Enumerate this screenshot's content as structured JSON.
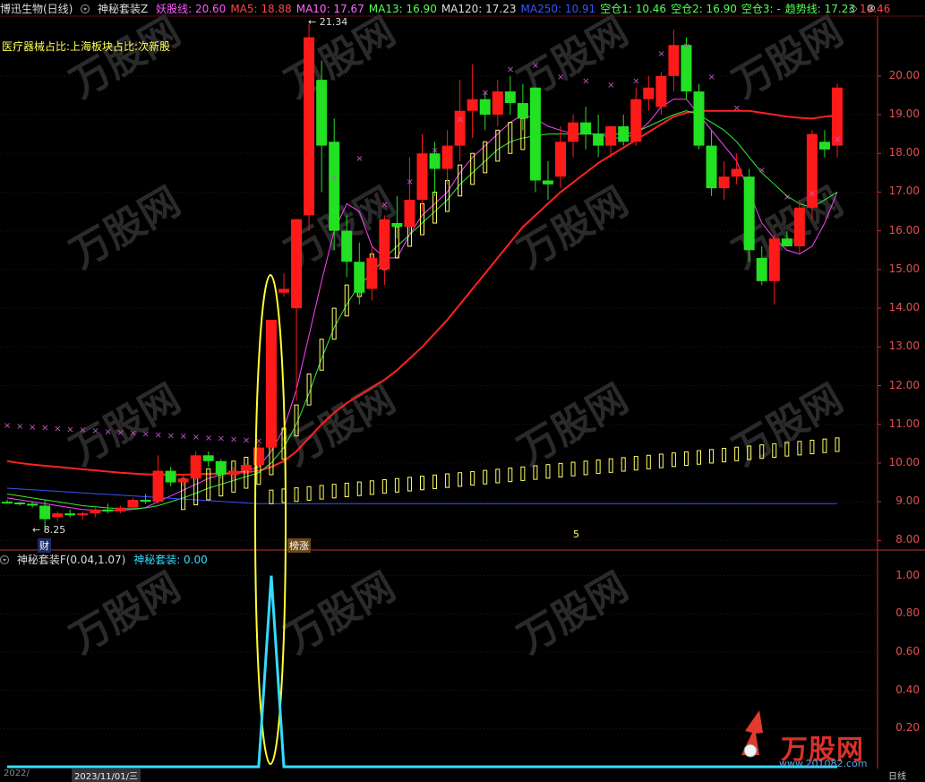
{
  "header": {
    "stock_name": "博迅生物(日线)",
    "indicator_name": "神秘套装Z",
    "values": [
      {
        "label": "妖股线: 20.60",
        "color": "#ff55ff"
      },
      {
        "label": "MA5: 18.88",
        "color": "#ff4444"
      },
      {
        "label": "MA10: 17.67",
        "color": "#ff66ff"
      },
      {
        "label": "MA13: 16.90",
        "color": "#55ff55"
      },
      {
        "label": "MA120: 17.23",
        "color": "#dddddd"
      },
      {
        "label": "MA250: 10.91",
        "color": "#3355ff"
      },
      {
        "label": "空仓1: 10.46",
        "color": "#55ff55"
      },
      {
        "label": "空仓2: 16.90",
        "color": "#55ff55"
      },
      {
        "label": "空仓3: -",
        "color": "#55ff55"
      },
      {
        "label": "趋势线: 17.23",
        "color": "#55ff55"
      },
      {
        "label": "10.46",
        "color": "#ff4444"
      }
    ]
  },
  "sector_line": "医疗器械占比:上海板块占比:次新股",
  "window_buttons": {
    "diamond": "◇",
    "close": "⊗"
  },
  "price_axis": [
    "20.00",
    "19.00",
    "18.00",
    "17.00",
    "16.00",
    "15.00",
    "14.00",
    "13.00",
    "12.00",
    "11.00",
    "10.00",
    "9.00",
    "8.00"
  ],
  "annotations": {
    "high": "21.34",
    "low": "8.25",
    "cai": "财",
    "bang": "榜涨",
    "five": "5"
  },
  "sub_header": {
    "indicator": "神秘套装F(0.04,1.07)",
    "value_label": "神秘套装: 0.00",
    "value_color": "#33ddff"
  },
  "sub_axis": [
    "1.00",
    "0.80",
    "0.60",
    "0.40",
    "0.20"
  ],
  "footer": {
    "left": "2022/",
    "date": "2023/11/01/三",
    "right": "日线"
  },
  "watermark": {
    "brand": "万股网",
    "url": "www.201082.com"
  },
  "colors": {
    "up": "#ff1a1a",
    "down": "#22e022",
    "ellipse": "#ffff33",
    "spike": "#33ddff"
  },
  "chart_data": [
    {
      "type": "candlestick",
      "title": "博迅生物(日线)",
      "ylim": [
        7.8,
        21.5
      ],
      "candles": [
        {
          "o": 9.0,
          "h": 9.05,
          "l": 8.95,
          "c": 8.98
        },
        {
          "o": 8.98,
          "h": 9.0,
          "l": 8.9,
          "c": 8.95
        },
        {
          "o": 8.95,
          "h": 9.0,
          "l": 8.85,
          "c": 8.9
        },
        {
          "o": 8.9,
          "h": 9.05,
          "l": 8.25,
          "c": 8.55
        },
        {
          "o": 8.6,
          "h": 8.75,
          "l": 8.5,
          "c": 8.7
        },
        {
          "o": 8.7,
          "h": 8.8,
          "l": 8.6,
          "c": 8.65
        },
        {
          "o": 8.65,
          "h": 8.75,
          "l": 8.55,
          "c": 8.7
        },
        {
          "o": 8.7,
          "h": 8.85,
          "l": 8.6,
          "c": 8.8
        },
        {
          "o": 8.8,
          "h": 8.95,
          "l": 8.7,
          "c": 8.75
        },
        {
          "o": 8.75,
          "h": 8.9,
          "l": 8.7,
          "c": 8.85
        },
        {
          "o": 8.85,
          "h": 9.1,
          "l": 8.8,
          "c": 9.05
        },
        {
          "o": 9.05,
          "h": 9.2,
          "l": 8.95,
          "c": 9.0
        },
        {
          "o": 9.0,
          "h": 10.2,
          "l": 8.95,
          "c": 9.8
        },
        {
          "o": 9.8,
          "h": 9.9,
          "l": 9.4,
          "c": 9.5
        },
        {
          "o": 9.5,
          "h": 9.7,
          "l": 9.4,
          "c": 9.6
        },
        {
          "o": 9.6,
          "h": 10.3,
          "l": 9.55,
          "c": 10.2
        },
        {
          "o": 10.2,
          "h": 10.3,
          "l": 9.9,
          "c": 10.05
        },
        {
          "o": 10.05,
          "h": 10.1,
          "l": 9.6,
          "c": 9.7
        },
        {
          "o": 9.7,
          "h": 9.9,
          "l": 9.55,
          "c": 9.8
        },
        {
          "o": 9.8,
          "h": 10.0,
          "l": 9.7,
          "c": 9.95
        },
        {
          "o": 9.95,
          "h": 10.5,
          "l": 9.9,
          "c": 10.4
        },
        {
          "o": 10.4,
          "h": 13.6,
          "l": 10.3,
          "c": 13.7
        },
        {
          "o": 14.4,
          "h": 14.9,
          "l": 14.3,
          "c": 14.5
        },
        {
          "o": 14.0,
          "h": 16.3,
          "l": 11.6,
          "c": 16.3
        },
        {
          "o": 16.4,
          "h": 21.34,
          "l": 16.0,
          "c": 21.0
        },
        {
          "o": 19.9,
          "h": 20.4,
          "l": 17.0,
          "c": 18.2
        },
        {
          "o": 18.3,
          "h": 18.9,
          "l": 15.5,
          "c": 16.0
        },
        {
          "o": 16.0,
          "h": 16.4,
          "l": 14.8,
          "c": 15.2
        },
        {
          "o": 15.2,
          "h": 15.7,
          "l": 14.1,
          "c": 14.4
        },
        {
          "o": 14.5,
          "h": 15.6,
          "l": 14.2,
          "c": 15.3
        },
        {
          "o": 15.0,
          "h": 16.4,
          "l": 14.6,
          "c": 16.3
        },
        {
          "o": 16.2,
          "h": 16.9,
          "l": 15.8,
          "c": 16.1
        },
        {
          "o": 16.1,
          "h": 17.9,
          "l": 15.9,
          "c": 16.8
        },
        {
          "o": 16.8,
          "h": 18.5,
          "l": 16.5,
          "c": 18.0
        },
        {
          "o": 18.0,
          "h": 18.3,
          "l": 16.9,
          "c": 17.6
        },
        {
          "o": 17.6,
          "h": 18.6,
          "l": 17.2,
          "c": 18.2
        },
        {
          "o": 18.2,
          "h": 19.9,
          "l": 17.8,
          "c": 19.1
        },
        {
          "o": 19.1,
          "h": 20.3,
          "l": 18.4,
          "c": 19.4
        },
        {
          "o": 19.4,
          "h": 19.6,
          "l": 18.6,
          "c": 19.0
        },
        {
          "o": 19.0,
          "h": 19.9,
          "l": 18.7,
          "c": 19.6
        },
        {
          "o": 19.6,
          "h": 20.0,
          "l": 19.0,
          "c": 19.3
        },
        {
          "o": 19.3,
          "h": 19.8,
          "l": 18.6,
          "c": 18.9
        },
        {
          "o": 19.7,
          "h": 19.7,
          "l": 17.0,
          "c": 17.3
        },
        {
          "o": 17.3,
          "h": 17.8,
          "l": 16.8,
          "c": 17.2
        },
        {
          "o": 17.4,
          "h": 18.7,
          "l": 17.1,
          "c": 18.3
        },
        {
          "o": 18.3,
          "h": 19.0,
          "l": 17.9,
          "c": 18.8
        },
        {
          "o": 18.8,
          "h": 19.2,
          "l": 18.1,
          "c": 18.5
        },
        {
          "o": 18.5,
          "h": 19.0,
          "l": 17.9,
          "c": 18.2
        },
        {
          "o": 18.2,
          "h": 18.7,
          "l": 17.9,
          "c": 18.7
        },
        {
          "o": 18.7,
          "h": 19.0,
          "l": 18.2,
          "c": 18.3
        },
        {
          "o": 18.3,
          "h": 19.7,
          "l": 18.2,
          "c": 19.4
        },
        {
          "o": 19.4,
          "h": 20.0,
          "l": 19.1,
          "c": 19.7
        },
        {
          "o": 19.2,
          "h": 20.1,
          "l": 19.0,
          "c": 20.0
        },
        {
          "o": 20.0,
          "h": 21.2,
          "l": 19.6,
          "c": 20.8
        },
        {
          "o": 20.8,
          "h": 21.0,
          "l": 19.4,
          "c": 19.6
        },
        {
          "o": 19.6,
          "h": 19.8,
          "l": 18.1,
          "c": 18.2
        },
        {
          "o": 18.2,
          "h": 18.6,
          "l": 16.9,
          "c": 17.1
        },
        {
          "o": 17.1,
          "h": 17.8,
          "l": 16.8,
          "c": 17.4
        },
        {
          "o": 17.4,
          "h": 18.0,
          "l": 17.2,
          "c": 17.6
        },
        {
          "o": 17.4,
          "h": 17.6,
          "l": 15.2,
          "c": 15.5
        },
        {
          "o": 15.3,
          "h": 15.6,
          "l": 14.6,
          "c": 14.7
        },
        {
          "o": 14.7,
          "h": 15.9,
          "l": 14.1,
          "c": 15.8
        },
        {
          "o": 15.8,
          "h": 16.0,
          "l": 15.6,
          "c": 15.6
        },
        {
          "o": 15.6,
          "h": 16.8,
          "l": 15.4,
          "c": 16.6
        },
        {
          "o": 16.6,
          "h": 18.6,
          "l": 16.3,
          "c": 18.5
        },
        {
          "o": 18.3,
          "h": 18.6,
          "l": 17.9,
          "c": 18.1
        },
        {
          "o": 18.2,
          "h": 19.8,
          "l": 17.9,
          "c": 19.7
        }
      ],
      "series": [
        {
          "color": "#ff2222",
          "values": [
            10.05,
            10.0,
            9.96,
            9.93,
            9.9,
            9.87,
            9.84,
            9.81,
            9.78,
            9.75,
            9.73,
            9.71,
            9.7,
            9.7,
            9.7,
            9.71,
            9.72,
            9.73,
            9.74,
            9.76,
            9.8,
            9.9,
            10.05,
            10.3,
            10.65,
            11.0,
            11.3,
            11.55,
            11.75,
            11.95,
            12.15,
            12.4,
            12.7,
            13.0,
            13.35,
            13.7,
            14.1,
            14.5,
            14.9,
            15.3,
            15.7,
            16.1,
            16.4,
            16.7,
            17.0,
            17.25,
            17.5,
            17.75,
            17.95,
            18.15,
            18.35,
            18.55,
            18.75,
            18.95,
            19.05,
            19.1,
            19.1,
            19.1,
            19.1,
            19.1,
            19.05,
            19.0,
            18.95,
            18.92,
            18.9,
            18.95,
            18.98
          ]
        },
        {
          "color": "#ff44ff",
          "values": [
            9.1,
            9.05,
            9.0,
            8.95,
            8.9,
            8.85,
            8.8,
            8.78,
            8.76,
            8.78,
            8.8,
            8.85,
            9.0,
            9.15,
            9.3,
            9.45,
            9.6,
            9.7,
            9.75,
            9.8,
            9.9,
            10.3,
            10.9,
            11.9,
            13.3,
            14.7,
            16.0,
            16.7,
            16.5,
            15.6,
            15.3,
            15.3,
            15.9,
            16.4,
            16.7,
            17.0,
            17.5,
            17.9,
            18.2,
            18.5,
            18.8,
            19.0,
            18.9,
            18.7,
            18.6,
            18.5,
            18.5,
            18.5,
            18.4,
            18.4,
            18.5,
            18.8,
            19.2,
            19.4,
            19.4,
            19.0,
            18.6,
            18.2,
            17.8,
            17.0,
            16.2,
            15.8,
            15.5,
            15.4,
            15.6,
            16.2,
            17.0
          ]
        },
        {
          "color": "#33ee33",
          "values": [
            9.2,
            9.15,
            9.1,
            9.05,
            9.0,
            8.95,
            8.9,
            8.87,
            8.84,
            8.82,
            8.82,
            8.84,
            8.9,
            9.0,
            9.1,
            9.22,
            9.35,
            9.45,
            9.55,
            9.65,
            9.75,
            10.0,
            10.4,
            11.0,
            11.8,
            12.7,
            13.5,
            14.1,
            14.6,
            14.9,
            15.3,
            15.6,
            15.9,
            16.2,
            16.5,
            16.8,
            17.2,
            17.5,
            17.8,
            18.1,
            18.3,
            18.4,
            18.45,
            18.5,
            18.5,
            18.5,
            18.5,
            18.5,
            18.5,
            18.5,
            18.55,
            18.7,
            18.85,
            19.0,
            19.1,
            19.0,
            18.8,
            18.6,
            18.3,
            17.9,
            17.5,
            17.2,
            16.9,
            16.7,
            16.6,
            16.8,
            17.0
          ]
        },
        {
          "color": "#3355ff",
          "values": [
            9.35,
            9.33,
            9.31,
            9.29,
            9.27,
            9.25,
            9.23,
            9.21,
            9.19,
            9.17,
            9.15,
            9.13,
            9.11,
            9.09,
            9.07,
            9.05,
            9.03,
            9.01,
            8.99,
            8.97,
            8.95,
            8.95,
            8.95,
            8.95,
            8.95,
            8.95,
            8.95,
            8.95,
            8.95,
            8.95,
            8.95,
            8.95,
            8.95,
            8.95,
            8.95,
            8.95,
            8.95,
            8.95,
            8.95,
            8.95,
            8.95,
            8.95,
            8.95,
            8.95,
            8.95,
            8.95,
            8.95,
            8.95,
            8.95,
            8.95,
            8.95,
            8.95,
            8.95,
            8.95,
            8.95,
            8.95,
            8.95,
            8.95,
            8.95,
            8.95,
            8.95,
            8.95,
            8.95,
            8.95,
            8.95,
            8.95,
            8.95
          ]
        }
      ]
    },
    {
      "type": "line",
      "title": "神秘套装F(0.04,1.07)",
      "ylim": [
        0,
        1.05
      ],
      "values": [
        0,
        0,
        0,
        0,
        0,
        0,
        0,
        0,
        0,
        0,
        0,
        0,
        0,
        0,
        0,
        0,
        0,
        0,
        0,
        0,
        0,
        1.0,
        0,
        0,
        0,
        0,
        0,
        0,
        0,
        0,
        0,
        0,
        0,
        0,
        0,
        0,
        0,
        0,
        0,
        0,
        0,
        0,
        0,
        0,
        0,
        0,
        0,
        0,
        0,
        0,
        0,
        0,
        0,
        0,
        0,
        0,
        0,
        0,
        0,
        0,
        0,
        0,
        0,
        0,
        0,
        0,
        0
      ],
      "series": [
        {
          "name": "神秘套装",
          "values": [
            0
          ]
        }
      ]
    }
  ]
}
